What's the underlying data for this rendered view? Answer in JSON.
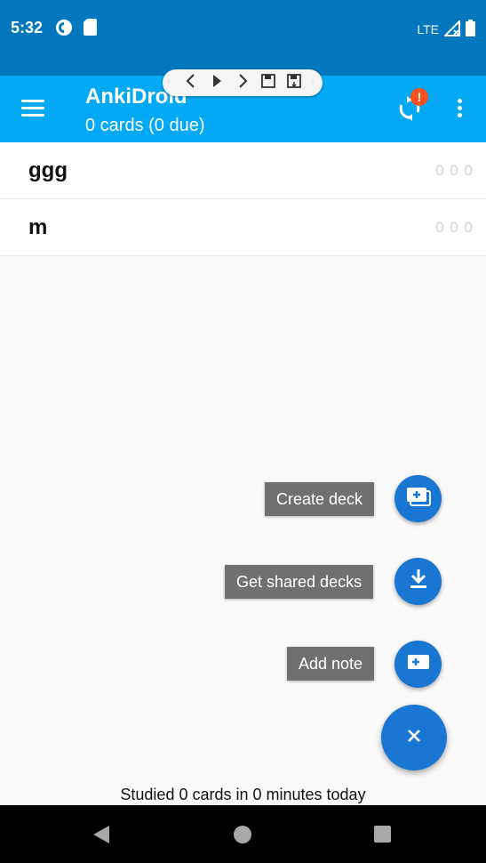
{
  "status_bar": {
    "time": "5:32",
    "network": "LTE",
    "icons": [
      "pocket-casts-icon",
      "sd-card-icon",
      "signal-icon",
      "battery-icon"
    ]
  },
  "toolbar": {
    "title": "AnkiDroid",
    "subtitle": "0 cards (0 due)",
    "sync_badge": "!",
    "icons": [
      "menu-icon",
      "sync-icon",
      "more-vert-icon"
    ]
  },
  "nav_overlay": {
    "icons": [
      "drag-handle-icon",
      "chevron-left-icon",
      "play-icon",
      "chevron-right-icon",
      "save-icon",
      "save-as-icon",
      "drag-handle-icon"
    ]
  },
  "decks": [
    {
      "name": "ggg",
      "counts": "0 0 0"
    },
    {
      "name": "m",
      "counts": "0 0 0"
    }
  ],
  "fab_menu": {
    "create_deck": "Create deck",
    "get_shared_decks": "Get shared decks",
    "add_note": "Add note",
    "main_icon": "close-icon"
  },
  "footer": {
    "studied": "Studied 0 cards in 0 minutes today"
  },
  "colors": {
    "status_bar": "#0277bd",
    "toolbar": "#03a9f4",
    "fab": "#1976d2",
    "badge": "#f4511e",
    "label_bg": "#707070"
  }
}
